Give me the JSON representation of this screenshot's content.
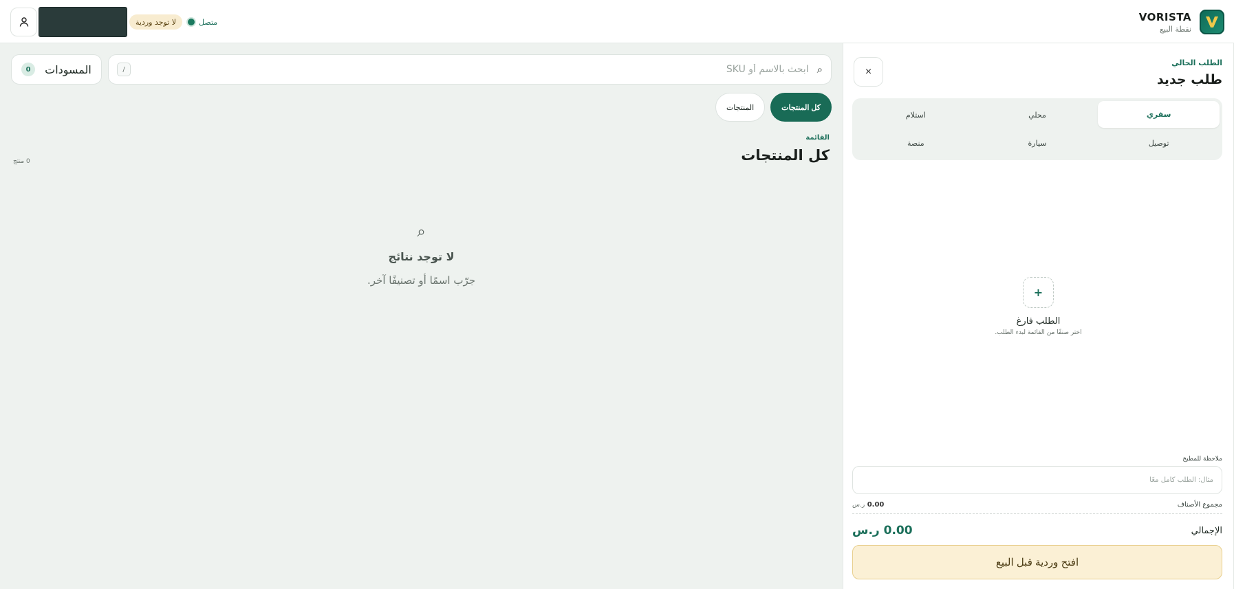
{
  "header": {
    "brand_name": "VORISTA",
    "brand_sub": "نقطة البيع",
    "status_label": "متصل",
    "shift_badge": "لا توجد وردية"
  },
  "main": {
    "search_placeholder": "ابحث بالاسم أو SKU",
    "search_shortcut": "/",
    "drafts_label": "المسودات",
    "drafts_count": "0",
    "chips": [
      {
        "label": "كل المنتجات",
        "active": true
      },
      {
        "label": "المنتجات",
        "active": false
      }
    ],
    "section_label": "القائمة",
    "section_title": "كل المنتجات",
    "product_count": "0 منتج",
    "empty_title": "لا توجد نتائج",
    "empty_subtitle": "جرّب اسمًا أو تصنيفًا آخر."
  },
  "order": {
    "label": "الطلب الحالي",
    "title": "طلب جديد",
    "close_symbol": "×",
    "types": [
      {
        "label": "سفري",
        "active": true
      },
      {
        "label": "محلي",
        "active": false
      },
      {
        "label": "استلام",
        "active": false
      },
      {
        "label": "توصيل",
        "active": false
      },
      {
        "label": "سيارة",
        "active": false
      },
      {
        "label": "منصة",
        "active": false
      }
    ],
    "empty_symbol": "+",
    "empty_title": "الطلب فارغ",
    "empty_subtitle": "اختر صنفًا من القائمة لبدء الطلب.",
    "note_label": "ملاحظة للمطبخ",
    "note_placeholder": "مثال: الطلب كامل معًا",
    "subtotal_label": "مجموع الأصناف",
    "subtotal_value": "0.00",
    "subtotal_currency": "ر.س",
    "total_label": "الإجمالي",
    "total_value": "0.00 ر.س",
    "cta_label": "افتح وردية قبل البيع"
  },
  "colors": {
    "accent": "#196b56",
    "background": "#eef2ef",
    "warning_bg": "#fbf0d5"
  }
}
